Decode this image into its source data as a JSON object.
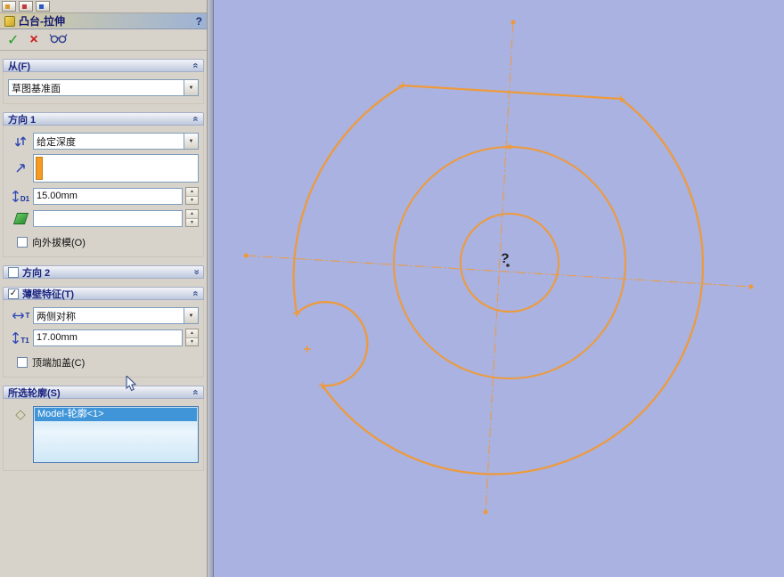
{
  "colors": {
    "panel_bg": "#d7d3cb",
    "vp_bg": "#a9b2e1",
    "sketch": "#ef9a3a",
    "header_text": "#1c2680",
    "header_top": "#f3f4f8",
    "header_bot": "#bec8dd",
    "title_left": "#d8cda2",
    "title_right": "#9cb2d6",
    "input_border": "#7f9db9",
    "sel_blue": "#3f95d8",
    "orange_bar": "#f59b24",
    "splitter": "#98a0b4",
    "ok_green": "#1d9e1d",
    "cancel_red": "#cc2020"
  },
  "icons": {
    "ok": "✓",
    "cancel": "×",
    "check": "✓",
    "unchecked": "",
    "combo_arrow": "▼",
    "spin_up": "▲",
    "spin_down": "▼",
    "chevron": "»",
    "diamond": "◇"
  },
  "labels": {
    "d1": "D1",
    "t1": "T1",
    "t": "T"
  },
  "panel": {
    "title": "凸台-拉伸",
    "help": "?",
    "from": {
      "header": "从(F)",
      "plane": "草图基准面"
    },
    "direction1": {
      "header": "方向 1",
      "end_condition": "给定深度",
      "depth": "15.00mm",
      "draft": "",
      "outward_draft": "向外拔模(O)"
    },
    "direction2": {
      "header": "方向 2"
    },
    "thin": {
      "header": "薄壁特征(T)",
      "type": "两侧对称",
      "thickness": "17.00mm",
      "cap": "顶端加盖(C)"
    },
    "contours": {
      "header": "所选轮廓(S)",
      "selected_item": "Model-轮廓<1>"
    }
  },
  "viewport": {
    "origin_glyph": "?"
  }
}
